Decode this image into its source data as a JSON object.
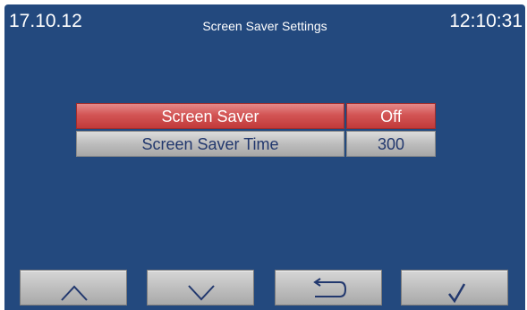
{
  "header": {
    "date": "17.10.12",
    "title": "Screen Saver Settings",
    "time": "12:10:31"
  },
  "settings": [
    {
      "label": "Screen Saver",
      "value": "Off",
      "selected": true
    },
    {
      "label": "Screen Saver Time",
      "value": "300",
      "selected": false
    }
  ],
  "buttons": [
    {
      "name": "up-button",
      "icon": "chevron-up-icon"
    },
    {
      "name": "down-button",
      "icon": "chevron-down-icon"
    },
    {
      "name": "back-button",
      "icon": "return-arrow-icon"
    },
    {
      "name": "confirm-button",
      "icon": "checkmark-icon"
    }
  ],
  "colors": {
    "background": "#23497e",
    "selected_row": "#d35555",
    "row": "#bdbdbd",
    "row_text": "#22386e"
  }
}
